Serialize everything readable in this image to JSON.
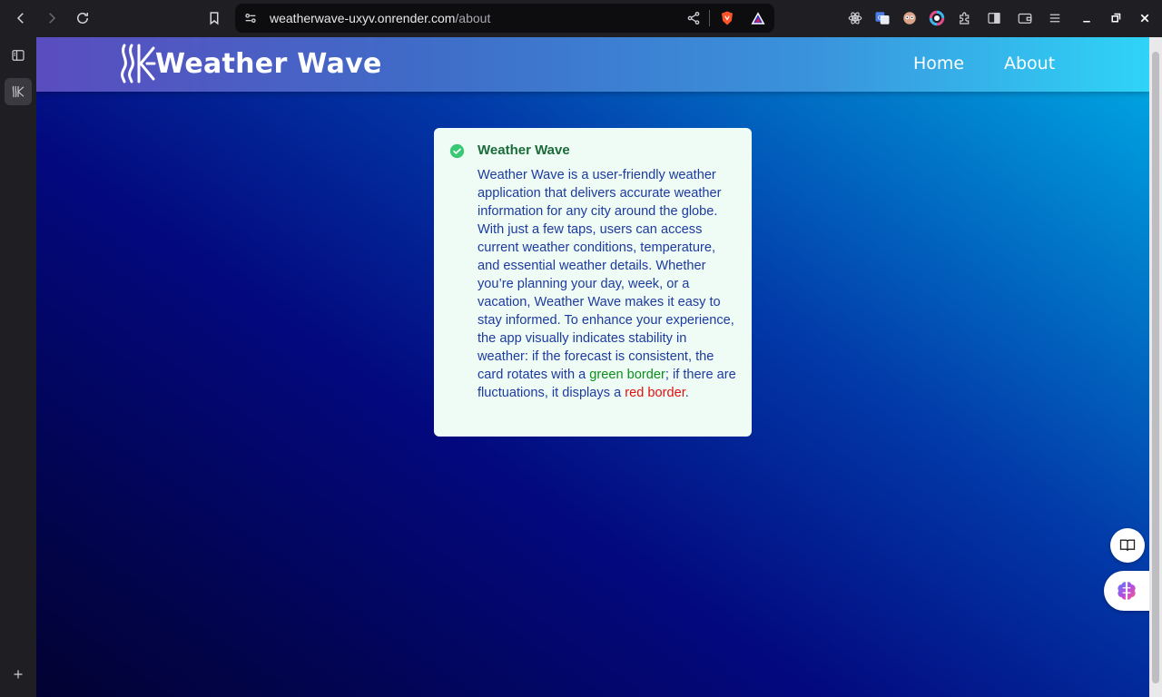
{
  "browser": {
    "url_host": "weatherwave-uxyv.onrender.com",
    "url_path": "/about",
    "icons": [
      "back-icon",
      "forward-icon",
      "reload-icon",
      "bookmark-icon",
      "site-settings-icon",
      "share-icon",
      "brave-shield-icon",
      "brave-rewards-icon",
      "react-devtools-icon",
      "translate-icon",
      "extension-eyes-icon",
      "color-picker-icon",
      "extensions-icon",
      "sidebar-toggle-icon",
      "wallet-icon",
      "menu-icon",
      "minimize-icon",
      "maximize-icon",
      "close-icon"
    ]
  },
  "sidebar": {
    "icons": [
      "sidebar-panel-icon",
      "weather-wave-tab-icon",
      "add-icon"
    ]
  },
  "site": {
    "brand": "Weather Wave",
    "nav": {
      "home": "Home",
      "about": "About"
    }
  },
  "card": {
    "title": "Weather Wave",
    "body_main": "Weather Wave is a user-friendly weather application that delivers accurate weather information for any city around the globe. With just a few taps, users can access current weather conditions, temperature, and essential weather details. Whether you’re planning your day, week, or a vacation, Weather Wave makes it easy to stay informed. To enhance your experience, the app visually indicates stability in weather: if the forecast is consistent, the card rotates with a ",
    "green_text": "green border",
    "body_mid": "; if there are fluctuations, it displays a ",
    "red_text": "red border",
    "body_end": "."
  },
  "colors": {
    "accent_green": "#0b8f1c",
    "accent_red": "#e01010",
    "card_bg": "#effcf5",
    "title_green": "#1b6b3a"
  }
}
